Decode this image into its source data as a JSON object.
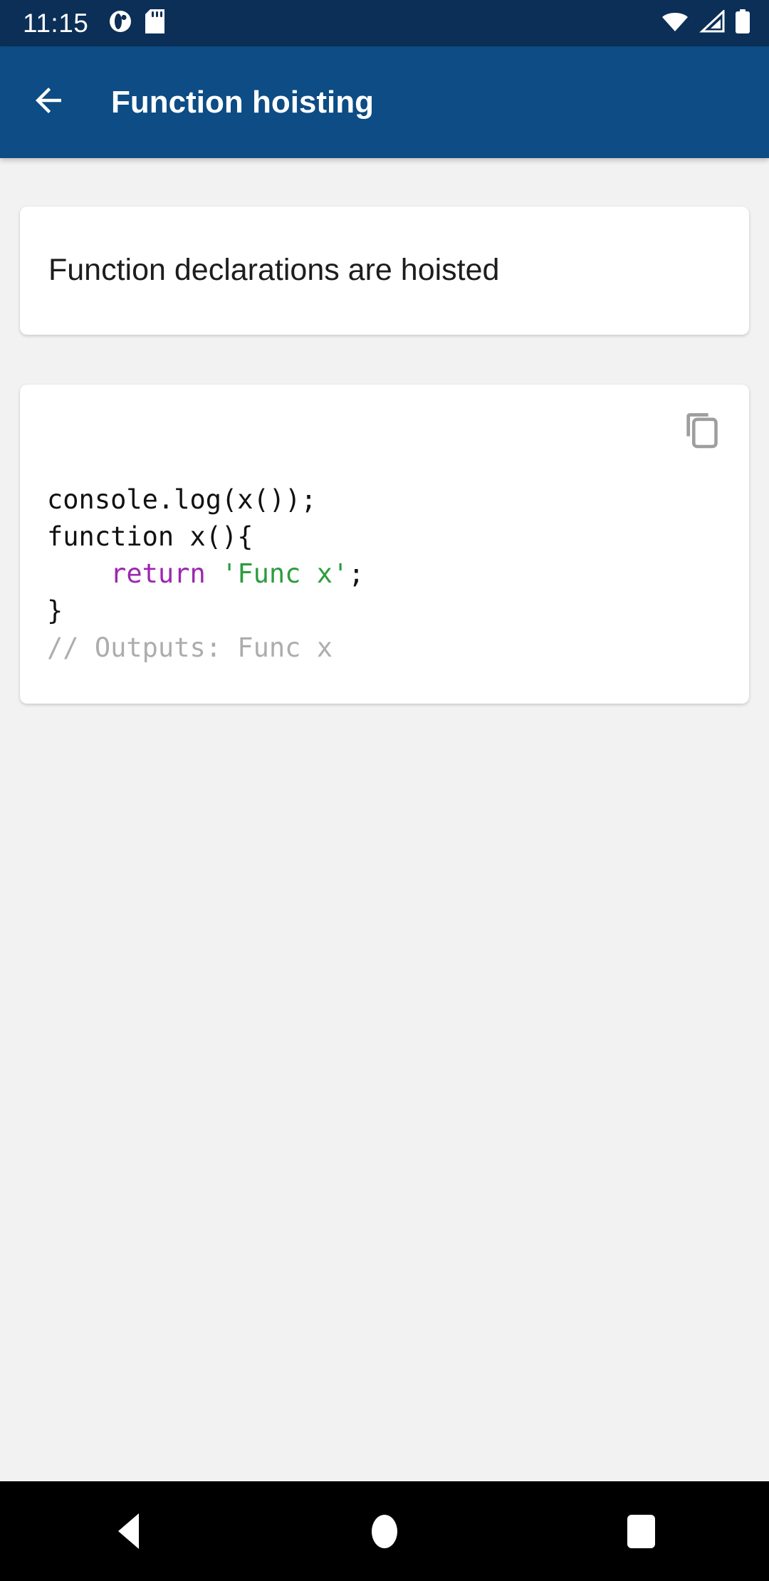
{
  "status_bar": {
    "clock": "11:15",
    "left_icons": [
      "app-notification-icon",
      "sd-card-icon"
    ],
    "right_icons": [
      "wifi-icon",
      "cellular-signal-icon",
      "battery-icon"
    ],
    "background_color": "#0B2F57",
    "foreground_color": "#FFFFFF"
  },
  "app_bar": {
    "back_icon": "arrow-back-icon",
    "title": "Function hoisting",
    "background_color": "#0D4C84",
    "title_color": "#FFFFFF"
  },
  "main": {
    "background_color": "#F2F2F2",
    "title_card": {
      "text": "Function declarations are hoisted"
    },
    "code_card": {
      "copy_icon": "copy-icon",
      "copy_icon_color": "#9E9E9E",
      "language": "javascript",
      "code_plain": "console.log(x());\nfunction x(){\n    return 'Func x';\n}\n// Outputs: Func x",
      "lines": [
        {
          "tokens": [
            {
              "text": "console.log(x());",
              "type": "plain"
            }
          ]
        },
        {
          "tokens": [
            {
              "text": "function x(){",
              "type": "plain"
            }
          ]
        },
        {
          "tokens": [
            {
              "text": "    ",
              "type": "plain"
            },
            {
              "text": "return",
              "type": "keyword"
            },
            {
              "text": " ",
              "type": "plain"
            },
            {
              "text": "'Func x'",
              "type": "string"
            },
            {
              "text": ";",
              "type": "plain"
            }
          ]
        },
        {
          "tokens": [
            {
              "text": "}",
              "type": "plain"
            }
          ]
        },
        {
          "tokens": [
            {
              "text": "// Outputs: Func x",
              "type": "comment"
            }
          ]
        }
      ],
      "token_colors": {
        "plain": "#111111",
        "keyword": "#9C27B0",
        "string": "#2E9B3F",
        "comment": "#ADADAD"
      }
    }
  },
  "nav_bar": {
    "background_color": "#000000",
    "buttons": [
      {
        "name": "back",
        "icon": "triangle-back-icon"
      },
      {
        "name": "home",
        "icon": "circle-home-icon"
      },
      {
        "name": "recents",
        "icon": "square-recents-icon"
      }
    ]
  }
}
